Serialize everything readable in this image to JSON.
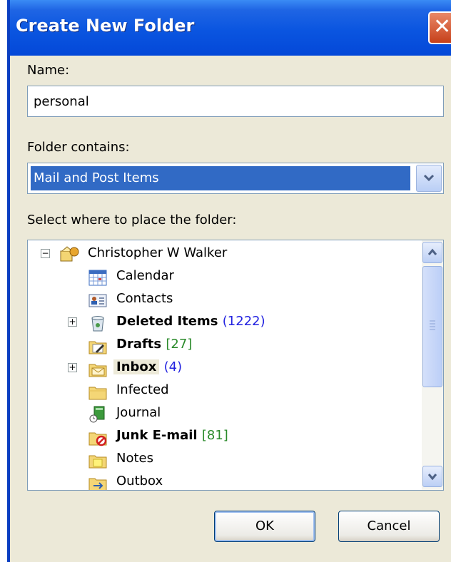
{
  "dialog": {
    "title": "Create New Folder",
    "close_icon": "close-icon"
  },
  "form": {
    "name_label": "Name:",
    "name_value": "personal",
    "contains_label": "Folder contains:",
    "contains_value": "Mail and Post Items",
    "place_label": "Select where to place the folder:"
  },
  "tree": {
    "root": {
      "label": "Christopher W Walker",
      "icon": "mailbox-icon",
      "expanded": true
    },
    "items": [
      {
        "label": "Calendar",
        "count": "",
        "bold": false,
        "icon": "calendar-icon",
        "expander": false
      },
      {
        "label": "Contacts",
        "count": "",
        "bold": false,
        "icon": "contacts-icon",
        "expander": false
      },
      {
        "label": "Deleted Items",
        "count": "(1222)",
        "bold": true,
        "icon": "trash-icon",
        "expander": true
      },
      {
        "label": "Drafts",
        "count": "[27]",
        "bold": true,
        "icon": "drafts-icon",
        "expander": false
      },
      {
        "label": "Inbox",
        "count": "(4)",
        "bold": true,
        "icon": "inbox-icon",
        "expander": true
      },
      {
        "label": "Infected",
        "count": "",
        "bold": false,
        "icon": "folder-icon",
        "expander": false
      },
      {
        "label": "Journal",
        "count": "",
        "bold": false,
        "icon": "journal-icon",
        "expander": false
      },
      {
        "label": "Junk E-mail",
        "count": "[81]",
        "bold": true,
        "icon": "junk-mail-icon",
        "expander": false
      },
      {
        "label": "Notes",
        "count": "",
        "bold": false,
        "icon": "notes-icon",
        "expander": false
      },
      {
        "label": "Outbox",
        "count": "",
        "bold": false,
        "icon": "outbox-icon",
        "expander": false
      }
    ]
  },
  "buttons": {
    "ok": "OK",
    "cancel": "Cancel"
  },
  "colors": {
    "titlebar": "#0A55E0",
    "selection": "#316AC5",
    "dialog_bg": "#ECE9D8",
    "count_blue": "#2323E0",
    "count_green": "#2A8A2A"
  }
}
